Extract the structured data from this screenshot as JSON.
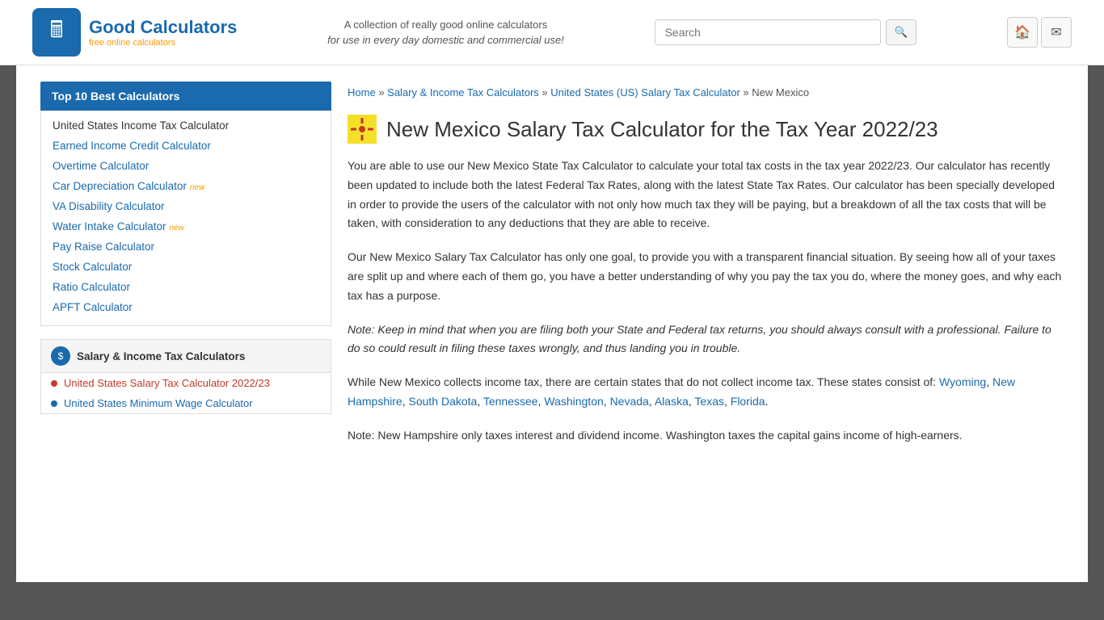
{
  "header": {
    "logo_title": "Good Calculators",
    "logo_subtitle": "free online calculators",
    "tagline_line1": "A collection of really good online calculators",
    "tagline_line2": "for use in every day domestic and commercial use!",
    "search_placeholder": "Search",
    "home_icon": "🏠",
    "mail_icon": "✉"
  },
  "sidebar": {
    "top_label": "Top 10 Best Calculators",
    "links": [
      {
        "text": "United States Income Tax Calculator",
        "color": "dark",
        "badge": ""
      },
      {
        "text": "Earned Income Credit Calculator",
        "color": "blue",
        "badge": ""
      },
      {
        "text": "Overtime Calculator",
        "color": "blue",
        "badge": ""
      },
      {
        "text": "Car Depreciation Calculator",
        "color": "blue",
        "badge": "new"
      },
      {
        "text": "VA Disability Calculator",
        "color": "blue",
        "badge": ""
      },
      {
        "text": "Water Intake Calculator",
        "color": "blue",
        "badge": "new"
      },
      {
        "text": "Pay Raise Calculator",
        "color": "blue",
        "badge": ""
      },
      {
        "text": "Stock Calculator",
        "color": "blue",
        "badge": ""
      },
      {
        "text": "Ratio Calculator",
        "color": "blue",
        "badge": ""
      },
      {
        "text": "APFT Calculator",
        "color": "blue",
        "badge": ""
      }
    ],
    "section_title": "Salary & Income Tax Calculators",
    "section_icon": "$",
    "sub_links": [
      {
        "text": "United States Salary Tax Calculator 2022/23",
        "color": "red",
        "dot": "red"
      },
      {
        "text": "United States Minimum Wage Calculator",
        "color": "blue",
        "dot": "blue"
      }
    ]
  },
  "breadcrumb": {
    "home": "Home",
    "salary": "Salary & Income Tax Calculators",
    "us_salary": "United States (US) Salary Tax Calculator",
    "current": "New Mexico"
  },
  "main": {
    "page_title": "New Mexico Salary Tax Calculator for the Tax Year 2022/23",
    "flag_emoji": "🟡",
    "para1": "You are able to use our New Mexico State Tax Calculator to calculate your total tax costs in the tax year 2022/23. Our calculator has recently been updated to include both the latest Federal Tax Rates, along with the latest State Tax Rates. Our calculator has been specially developed in order to provide the users of the calculator with not only how much tax they will be paying, but a breakdown of all the tax costs that will be taken, with consideration to any deductions that they are able to receive.",
    "para2": "Our New Mexico Salary Tax Calculator has only one goal, to provide you with a transparent financial situation. By seeing how all of your taxes are split up and where each of them go, you have a better understanding of why you pay the tax you do, where the money goes, and why each tax has a purpose.",
    "para3_italic": "Note: Keep in mind that when you are filing both your State and Federal tax returns, you should always consult with a professional. Failure to do so could result in filing these taxes wrongly, and thus landing you in trouble.",
    "para4_prefix": "While New Mexico collects income tax, there are certain states that do not collect income tax. These states consist of: ",
    "para4_suffix": ".",
    "no_tax_states": [
      "Wyoming",
      "New Hampshire",
      "South Dakota",
      "Tennessee",
      "Washington",
      "Nevada",
      "Alaska",
      "Texas",
      "Florida"
    ],
    "para5": "Note: New Hampshire only taxes interest and dividend income. Washington taxes the capital gains income of high-earners."
  }
}
